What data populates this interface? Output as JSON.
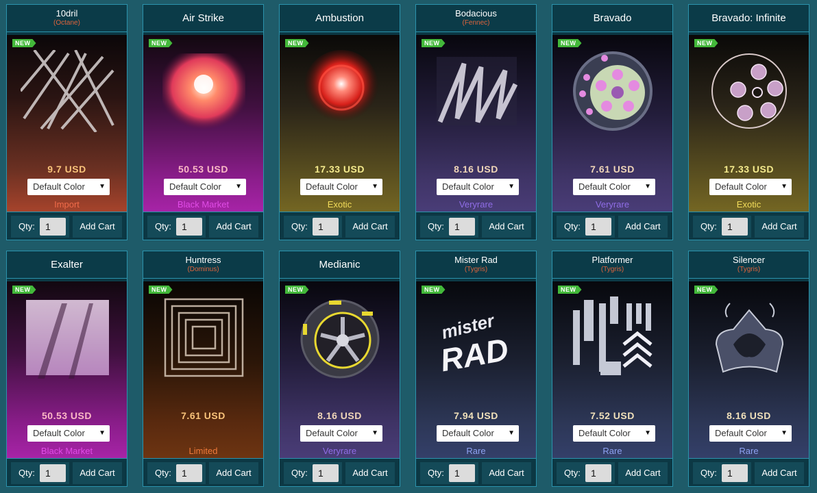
{
  "new_badge": "NEW",
  "qty_label": "Qty:",
  "add_label": "Add Cart",
  "color_label": "Default Color",
  "items": [
    {
      "name": "10dril",
      "sub": "(Octane)",
      "price": "9.7  USD",
      "rarity": "Import",
      "qty": "1",
      "art": "lines-icon"
    },
    {
      "name": "Air Strike",
      "sub": "",
      "price": "50.53  USD",
      "rarity": "Black Market",
      "qty": "1",
      "art": "explosion-icon"
    },
    {
      "name": "Ambustion",
      "sub": "",
      "price": "17.33  USD",
      "rarity": "Exotic",
      "qty": "1",
      "art": "fire-orb-icon"
    },
    {
      "name": "Bodacious",
      "sub": "(Fennec)",
      "price": "8.16  USD",
      "rarity": "Veryrare",
      "qty": "1",
      "art": "scribble-icon"
    },
    {
      "name": "Bravado",
      "sub": "",
      "price": "7.61  USD",
      "rarity": "Veryrare",
      "qty": "1",
      "art": "wheel-icon"
    },
    {
      "name": "Bravado: Infinite",
      "sub": "",
      "price": "17.33  USD",
      "rarity": "Exotic",
      "qty": "1",
      "art": "wheel-ring-icon"
    },
    {
      "name": "Exalter",
      "sub": "",
      "price": "50.53  USD",
      "rarity": "Black Market",
      "qty": "1",
      "art": "streak-icon"
    },
    {
      "name": "Huntress",
      "sub": "(Dominus)",
      "price": "7.61  USD",
      "rarity": "Limited",
      "qty": "1",
      "art": "squares-icon"
    },
    {
      "name": "Medianic",
      "sub": "",
      "price": "8.16  USD",
      "rarity": "Veryrare",
      "qty": "1",
      "art": "tire-icon"
    },
    {
      "name": "Mister Rad",
      "sub": "(Tygris)",
      "price": "7.94  USD",
      "rarity": "Rare",
      "qty": "1",
      "art": "rad-logo-icon"
    },
    {
      "name": "Platformer",
      "sub": "(Tygris)",
      "price": "7.52  USD",
      "rarity": "Rare",
      "qty": "1",
      "art": "chevrons-icon"
    },
    {
      "name": "Silencer",
      "sub": "(Tygris)",
      "price": "8.16  USD",
      "rarity": "Rare",
      "qty": "1",
      "art": "mask-icon"
    }
  ],
  "mr_art_text": {
    "top": "mister",
    "bottom": "RAD"
  }
}
